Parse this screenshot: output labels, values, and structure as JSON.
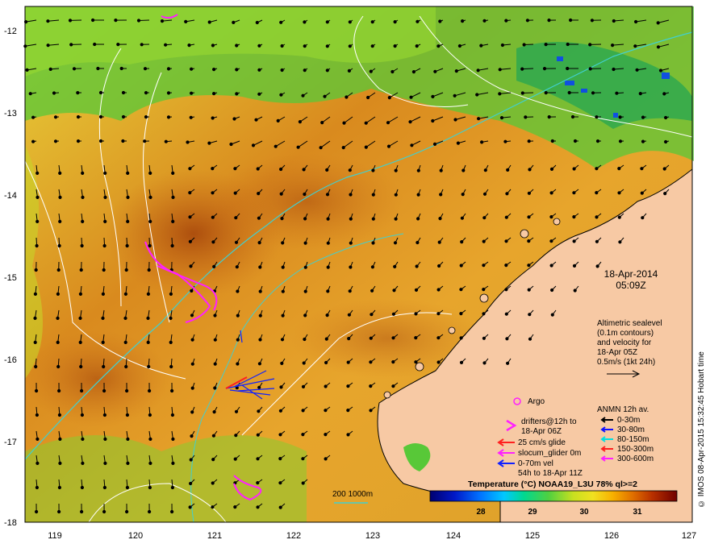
{
  "map": {
    "date": "18-Apr-2014",
    "time": "05:09Z",
    "credit": "© IMOS 08-Apr-2015 15:32:45 Hobart time",
    "lat_labels": [
      "-12",
      "-13",
      "-14",
      "-15",
      "-16",
      "-17",
      "-18"
    ],
    "lon_labels": [
      "119",
      "120",
      "121",
      "122",
      "123",
      "124",
      "125",
      "126",
      "127"
    ],
    "altimetry_note": [
      "Altimetric sealevel",
      "(0.1m contours)",
      "and velocity for",
      "18-Apr 05Z",
      "0.5m/s (1kt 24h)"
    ],
    "legend_left": {
      "argo": "Argo",
      "drifters": [
        "drifters@12h to",
        "18-Apr 06Z"
      ],
      "glide": "25 cm/s glide",
      "slocum": "slocum_glider 0m",
      "vel": [
        "0-70m vel",
        "54h to 18-Apr 11Z"
      ]
    },
    "legend_right": {
      "title": "ANMN 12h av.",
      "items": [
        {
          "label": "0-30m",
          "color": "#000000"
        },
        {
          "label": "30-80m",
          "color": "#1010ff"
        },
        {
          "label": "80-150m",
          "color": "#00e0e0"
        },
        {
          "label": "150-300m",
          "color": "#ff2020"
        },
        {
          "label": "300-600m",
          "color": "#ff20ff"
        }
      ]
    },
    "isobath_label": "200  1000m",
    "colorbar": {
      "title": "Temperature (°C) NOAA19_L3U 78% ql>=2",
      "ticks": [
        "28",
        "29",
        "30",
        "31"
      ]
    },
    "colors": {
      "land": "#f7c9a4",
      "isobath": "#40d0d0",
      "contour": "#ffffff"
    }
  }
}
